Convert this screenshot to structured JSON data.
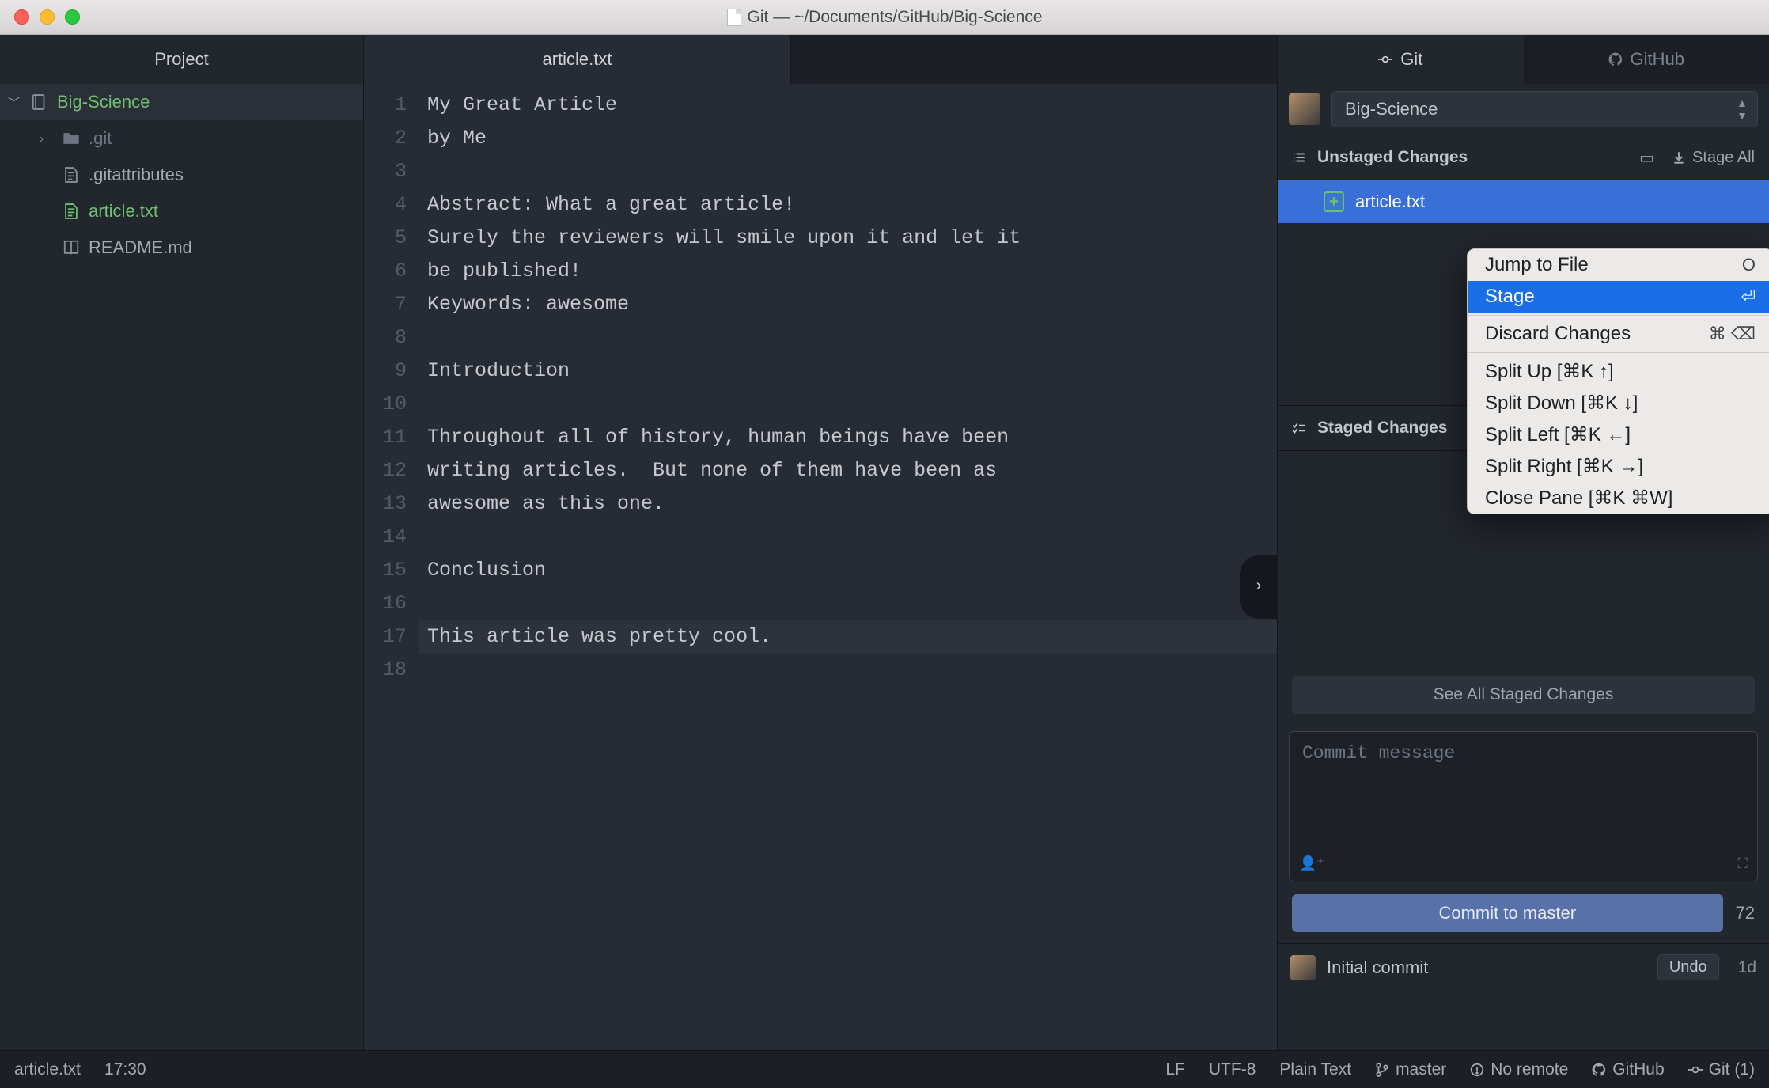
{
  "window": {
    "title": "Git — ~/Documents/GitHub/Big-Science"
  },
  "sidebar": {
    "header": "Project",
    "root": "Big-Science",
    "items": [
      {
        "label": ".git",
        "type": "folder"
      },
      {
        "label": ".gitattributes",
        "type": "file"
      },
      {
        "label": "article.txt",
        "type": "file-new"
      },
      {
        "label": "README.md",
        "type": "md"
      }
    ]
  },
  "tabs": {
    "active": "article.txt"
  },
  "editor": {
    "lines": [
      "My Great Article",
      "by Me",
      "",
      "Abstract: What a great article!",
      "Surely the reviewers will smile upon it and let it",
      "be published!",
      "Keywords: awesome",
      "",
      "Introduction",
      "",
      "Throughout all of history, human beings have been",
      "writing articles.  But none of them have been as",
      "awesome as this one.",
      "",
      "Conclusion",
      "",
      "This article was pretty cool.",
      ""
    ],
    "cursor_line": 17
  },
  "git": {
    "tab_git": "Git",
    "tab_github": "GitHub",
    "repo": "Big-Science",
    "unstaged_header": "Unstaged Changes",
    "stage_all": "Stage All",
    "unstaged_files": [
      {
        "name": "article.txt",
        "status": "+"
      }
    ],
    "staged_header": "Staged Changes",
    "see_all": "See All Staged Changes",
    "commit_placeholder": "Commit message",
    "commit_button": "Commit to master",
    "commit_count": "72",
    "last_commit": "Initial commit",
    "undo": "Undo",
    "time_ago": "1d"
  },
  "context_menu": {
    "items": [
      {
        "label": "Jump to File",
        "shortcut": "O"
      },
      {
        "label": "Stage",
        "shortcut": "⏎",
        "hover": true
      },
      {
        "sep": true
      },
      {
        "label": "Discard Changes",
        "shortcut": "⌘ ⌫"
      },
      {
        "sep": true
      },
      {
        "label": "Split Up [⌘K ↑]"
      },
      {
        "label": "Split Down [⌘K ↓]"
      },
      {
        "label": "Split Left [⌘K ←]"
      },
      {
        "label": "Split Right [⌘K →]"
      },
      {
        "label": "Close Pane [⌘K ⌘W]"
      }
    ]
  },
  "statusbar": {
    "file": "article.txt",
    "cursor": "17:30",
    "line_ending": "LF",
    "encoding": "UTF-8",
    "grammar": "Plain Text",
    "branch": "master",
    "remote": "No remote",
    "github": "GitHub",
    "git": "Git (1)"
  }
}
